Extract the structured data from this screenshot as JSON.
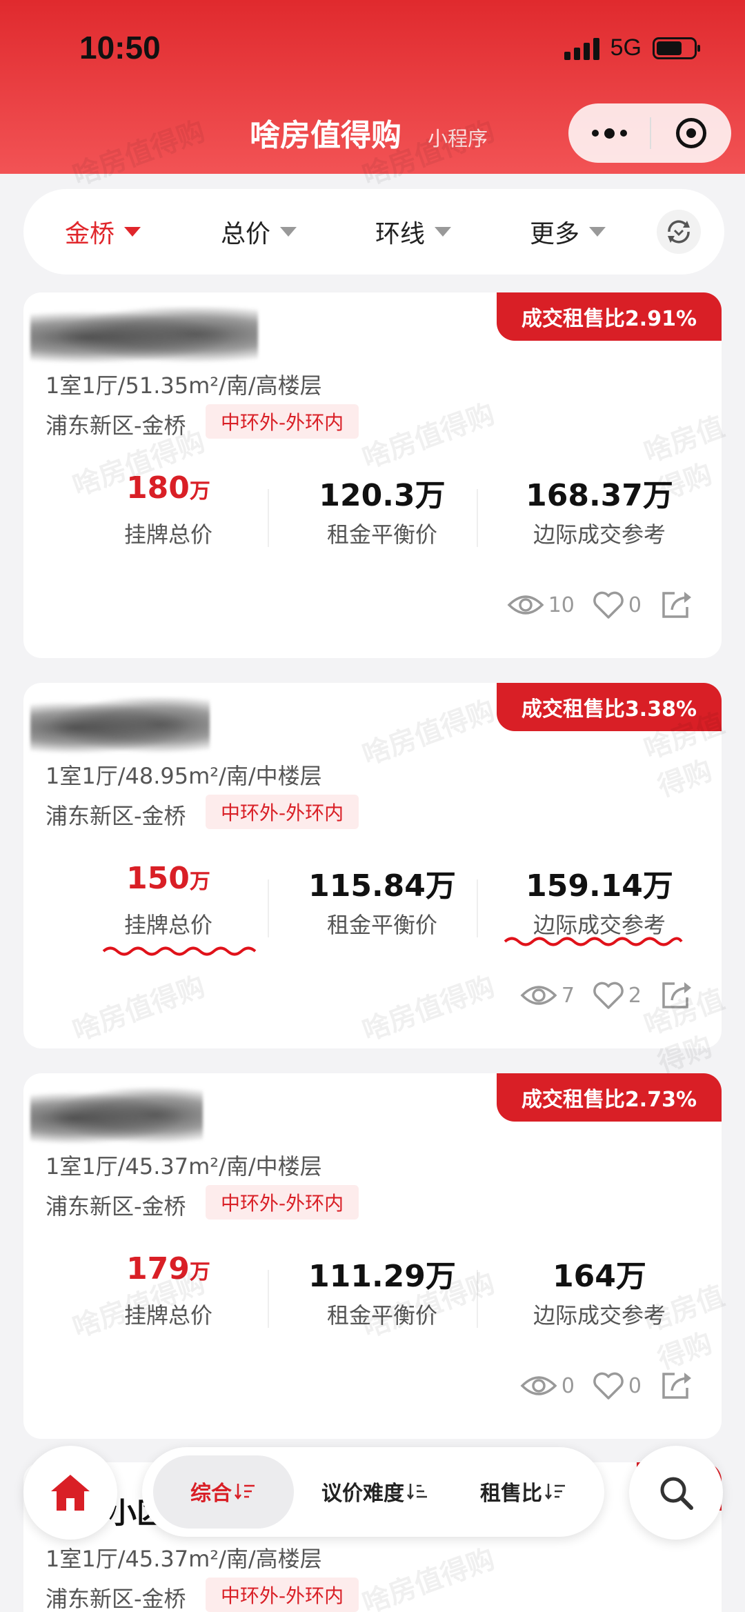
{
  "status": {
    "time": "10:50",
    "network": "5G"
  },
  "header": {
    "title": "啥房值得购",
    "subtitle": "小程序"
  },
  "filters": [
    {
      "label": "金桥",
      "active": true
    },
    {
      "label": "总价",
      "active": false
    },
    {
      "label": "环线",
      "active": false
    },
    {
      "label": "更多",
      "active": false
    }
  ],
  "watermark": "啥房值得购",
  "cards": [
    {
      "ratio": "成交租售比2.91%",
      "spec": "1室1厅/51.35m²/南/高楼层",
      "district": "浦东新区-金桥",
      "ring": "中环外-外环内",
      "list_price": "180",
      "list_price_unit": "万",
      "list_price_label": "挂牌总价",
      "rent_balance": "120.3万",
      "rent_balance_label": "租金平衡价",
      "marginal": "168.37万",
      "marginal_label": "边际成交参考",
      "views": "10",
      "likes": "0"
    },
    {
      "ratio": "成交租售比3.38%",
      "spec": "1室1厅/48.95m²/南/中楼层",
      "district": "浦东新区-金桥",
      "ring": "中环外-外环内",
      "list_price": "150",
      "list_price_unit": "万",
      "list_price_label": "挂牌总价",
      "rent_balance": "115.84万",
      "rent_balance_label": "租金平衡价",
      "marginal": "159.14万",
      "marginal_label": "边际成交参考",
      "views": "7",
      "likes": "2"
    },
    {
      "ratio": "成交租售比2.73%",
      "spec": "1室1厅/45.37m²/南/中楼层",
      "district": "浦东新区-金桥",
      "ring": "中环外-外环内",
      "list_price": "179",
      "list_price_unit": "万",
      "list_price_label": "挂牌总价",
      "rent_balance": "111.29万",
      "rent_balance_label": "租金平衡价",
      "marginal": "164万",
      "marginal_label": "边际成交参考",
      "views": "0",
      "likes": "0"
    }
  ],
  "card4": {
    "title_fragment": "小区",
    "ratio_fragment": "比2",
    "spec": "1室1厅/45.37m²/南/高楼层",
    "district": "浦东新区-金桥",
    "ring": "中环外-外环内"
  },
  "sort": [
    {
      "label": "综合",
      "active": true
    },
    {
      "label": "议价难度",
      "active": false
    },
    {
      "label": "租售比",
      "active": false
    }
  ]
}
